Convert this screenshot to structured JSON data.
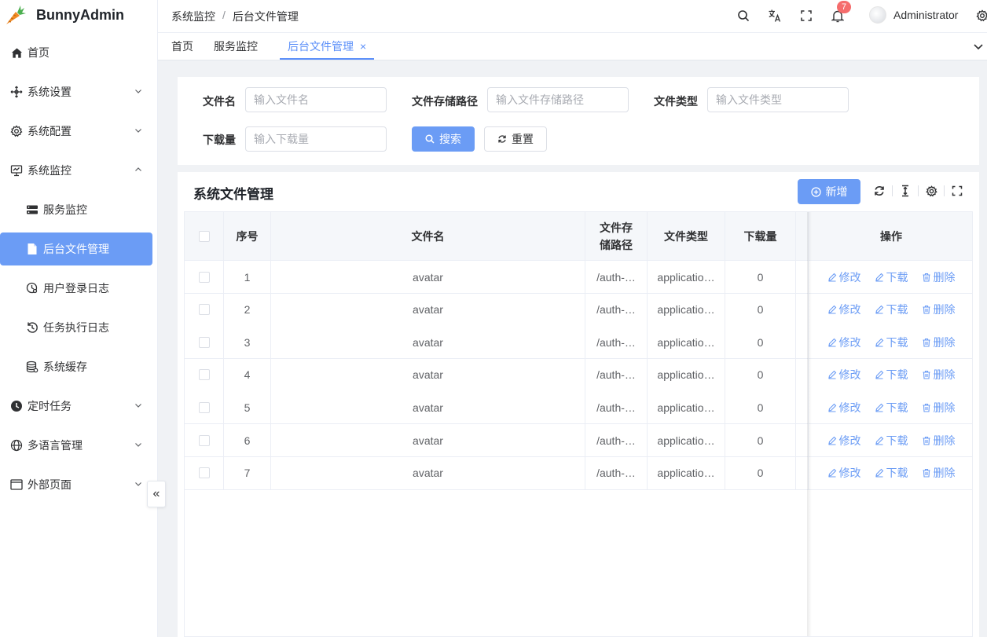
{
  "app": {
    "name": "BunnyAdmin"
  },
  "sidebar": {
    "items": [
      {
        "label": "首页",
        "icon": "home-icon"
      },
      {
        "label": "系统设置",
        "icon": "settings-move-icon"
      },
      {
        "label": "系统配置",
        "icon": "gear-icon"
      },
      {
        "label": "系统监控",
        "icon": "monitor-icon"
      },
      {
        "label": "服务监控",
        "icon": "server-icon"
      },
      {
        "label": "后台文件管理",
        "icon": "file-icon"
      },
      {
        "label": "用户登录日志",
        "icon": "user-log-icon"
      },
      {
        "label": "任务执行日志",
        "icon": "task-log-icon"
      },
      {
        "label": "系统缓存",
        "icon": "database-icon"
      },
      {
        "label": "定时任务",
        "icon": "clock-icon"
      },
      {
        "label": "多语言管理",
        "icon": "globe-icon"
      },
      {
        "label": "外部页面",
        "icon": "window-icon"
      }
    ]
  },
  "header": {
    "breadcrumb": [
      "系统监控",
      "后台文件管理"
    ],
    "notification_count": "7",
    "user": "Administrator"
  },
  "tabs": [
    {
      "label": "首页"
    },
    {
      "label": "服务监控"
    },
    {
      "label": "后台文件管理",
      "close": "×"
    }
  ],
  "search": {
    "filename_label": "文件名",
    "filename_placeholder": "输入文件名",
    "path_label": "文件存储路径",
    "path_placeholder": "输入文件存储路径",
    "type_label": "文件类型",
    "type_placeholder": "输入文件类型",
    "downloads_label": "下载量",
    "downloads_placeholder": "输入下载量",
    "search_button": "搜索",
    "reset_button": "重置"
  },
  "table": {
    "title": "系统文件管理",
    "add_button": "新增",
    "columns": {
      "index": "序号",
      "filename": "文件名",
      "path": "文件存储路径",
      "type": "文件类型",
      "downloads": "下载量",
      "actions": "操作"
    },
    "actions": {
      "edit": "修改",
      "download": "下载",
      "delete": "删除"
    },
    "rows": [
      {
        "index": "1",
        "filename": "avatar",
        "path": "/auth-…",
        "type": "applicatio…",
        "downloads": "0"
      },
      {
        "index": "2",
        "filename": "avatar",
        "path": "/auth-…",
        "type": "applicatio…",
        "downloads": "0"
      },
      {
        "index": "3",
        "filename": "avatar",
        "path": "/auth-…",
        "type": "applicatio…",
        "downloads": "0"
      },
      {
        "index": "4",
        "filename": "avatar",
        "path": "/auth-…",
        "type": "applicatio…",
        "downloads": "0"
      },
      {
        "index": "5",
        "filename": "avatar",
        "path": "/auth-…",
        "type": "applicatio…",
        "downloads": "0"
      },
      {
        "index": "6",
        "filename": "avatar",
        "path": "/auth-…",
        "type": "applicatio…",
        "downloads": "0"
      },
      {
        "index": "7",
        "filename": "avatar",
        "path": "/auth-…",
        "type": "applicatio…",
        "downloads": "0"
      }
    ]
  },
  "colors": {
    "primary": "#6b9cf5",
    "badge": "#f56c6c"
  }
}
